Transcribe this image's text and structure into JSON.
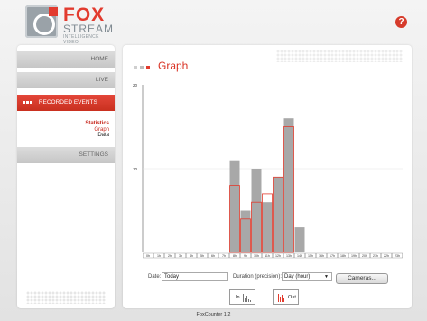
{
  "header": {
    "brand": "FOX",
    "brand2": "STREAM",
    "tagline": "INTELLIGENCE VIDEO",
    "help_icon": "help-icon",
    "help_glyph": "?"
  },
  "sidebar": {
    "items": [
      {
        "label": "HOME"
      },
      {
        "label": "LIVE"
      },
      {
        "label": "RECORDED EVENTS"
      },
      {
        "label": "SETTINGS"
      }
    ],
    "subitems": [
      {
        "label": "Statistics"
      },
      {
        "label": "Graph"
      },
      {
        "label": "Data"
      }
    ]
  },
  "main": {
    "title": "Graph"
  },
  "controls": {
    "date_label": "Date:",
    "date_value": "Today",
    "duration_label": "Duration (precision):",
    "duration_value": "Day (hour)",
    "cameras_label": "Cameras...",
    "in_label": "In",
    "out_label": "Out"
  },
  "footer": {
    "version": "FoxCounter 1.2"
  },
  "colors": {
    "accent": "#d93426",
    "bar_fill": "#a8a8a8",
    "out_outline": "#e23b2e"
  },
  "chart_data": {
    "type": "bar",
    "categories": [
      "0h",
      "1h",
      "2h",
      "3h",
      "4h",
      "5h",
      "6h",
      "7h",
      "8h",
      "9h",
      "10h",
      "11h",
      "12h",
      "13h",
      "14h",
      "15h",
      "16h",
      "17h",
      "18h",
      "19h",
      "20h",
      "21h",
      "22h",
      "23h"
    ],
    "series": [
      {
        "name": "In",
        "values": [
          0,
          0,
          0,
          0,
          0,
          0,
          0,
          0,
          11,
          5,
          10,
          6,
          9,
          16,
          3,
          0,
          0,
          0,
          0,
          0,
          0,
          0,
          0,
          0
        ]
      },
      {
        "name": "Out",
        "values": [
          0,
          0,
          0,
          0,
          0,
          0,
          0,
          0,
          8,
          4,
          6,
          7,
          9,
          15,
          0,
          0,
          0,
          0,
          0,
          0,
          0,
          0,
          0,
          0
        ]
      }
    ],
    "yticks": [
      "20",
      "10"
    ],
    "ylim": [
      0,
      20
    ]
  }
}
